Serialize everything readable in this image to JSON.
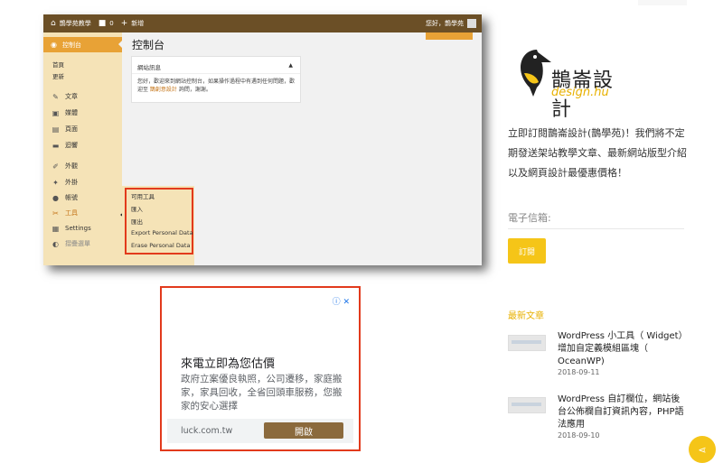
{
  "wp": {
    "adminbar": {
      "home_icon": "home-icon",
      "site_name": "鵲學苑教學",
      "comment_icon": "comment-icon",
      "comment_count": "0",
      "new_icon": "plus-icon",
      "new_label": "新增",
      "greeting": "您好，鵲學苑"
    },
    "menu": {
      "current_label": "控制台",
      "current_icon": "dashboard-icon",
      "submenu": [
        "首頁",
        "更新"
      ],
      "items": [
        {
          "icon": "pin-icon",
          "glyph": "✎",
          "label": "文章"
        },
        {
          "icon": "media-icon",
          "glyph": "▣",
          "label": "媒體"
        },
        {
          "icon": "page-icon",
          "glyph": "▤",
          "label": "頁面"
        },
        {
          "icon": "comment-icon",
          "glyph": "▬",
          "label": "迴響"
        },
        {
          "icon": "appearance-icon",
          "glyph": "✐",
          "label": "外觀"
        },
        {
          "icon": "plugin-icon",
          "glyph": "✦",
          "label": "外掛"
        },
        {
          "icon": "user-icon",
          "glyph": "●",
          "label": "帳號"
        },
        {
          "icon": "wrench-icon",
          "glyph": "✂",
          "label": "工具"
        },
        {
          "icon": "settings-icon",
          "glyph": "▦",
          "label": "Settings"
        },
        {
          "icon": "collapse-icon",
          "glyph": "◐",
          "label": "摺疊選單"
        }
      ]
    },
    "tools_submenu": [
      "可用工具",
      "匯入",
      "匯出",
      "Export Personal Data",
      "Erase Personal Data"
    ],
    "page_title": "控制台",
    "widget": {
      "title": "網站訊息",
      "toggle": "▲",
      "body_1": "您好，歡迎來到網站控制台，如果操作過程中有遇到任何問題，歡迎至 ",
      "body_link": "鵲創意設計",
      "body_2": " 詢問，謝謝。"
    }
  },
  "ad": {
    "icons": "ⓘ ✕",
    "title": "來電立即為您估價",
    "description": "政府立案優良執照，公司遷移，家庭搬家，家具回收，全省回頭車服務，您搬家的安心選擇",
    "url": "luck.com.tw",
    "button": "開啟"
  },
  "sidebar": {
    "logo_text": "鵲崙設計",
    "logo_sub": "design.hu",
    "promo": "立即訂閱鵲崙設計(鵲學苑)！我們將不定期發送架站教學文章、最新網站版型介紹以及網頁設計最優惠價格！",
    "email_label": "電子信箱:",
    "subscribe_label": "訂閱",
    "recent_heading": "最新文章",
    "posts": [
      {
        "title": "WordPress 小工具（ Widget）增加自定義模組區塊（ OceanWP)",
        "date": "2018-09-11"
      },
      {
        "title": "WordPress 自訂欄位，網站後台公佈欄自訂資訊內容，PHP語法應用",
        "date": "2018-09-10"
      }
    ],
    "share_icon": "share-icon"
  },
  "colors": {
    "adminbar": "#6b4f26",
    "menu_bg": "#f5e3b7",
    "menu_current": "#e8a236",
    "highlight_border": "#e23a1c",
    "accent_yellow": "#f5c518",
    "ad_button": "#8b6a3d"
  }
}
